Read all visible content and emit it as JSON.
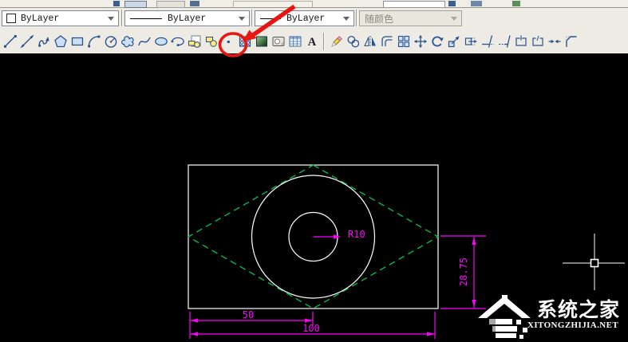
{
  "combo_row": {
    "color": "ByLayer",
    "linetype": "ByLayer",
    "lineweight": "ByLayer",
    "plotstyle": "随颜色"
  },
  "toolbar": {
    "icons": [
      "line",
      "construction-line",
      "polyline",
      "polygon",
      "rectangle",
      "arc",
      "circle",
      "revision-cloud",
      "spline",
      "ellipse",
      "ellipse-arc",
      "insert-block",
      "make-block",
      "point",
      "hatch",
      "gradient",
      "region",
      "table",
      "multiline-text",
      "erase",
      "copy",
      "mirror",
      "offset",
      "array",
      "move",
      "rotate",
      "scale",
      "stretch",
      "trim",
      "extend",
      "break-at-point",
      "break",
      "join",
      "chamfer"
    ],
    "highlighted_icon": "make-block"
  },
  "drawing": {
    "dimensions": {
      "radius": "R10",
      "half_width": "50",
      "full_width": "100",
      "height": "28.75"
    },
    "colors": {
      "geometry": "#ffffff",
      "construction": "#00c455",
      "dimension": "#ff00ff",
      "highlight": "#e81510"
    }
  },
  "watermark": {
    "title": "系统之家",
    "site": "XITONGZHIJIA.NET"
  }
}
